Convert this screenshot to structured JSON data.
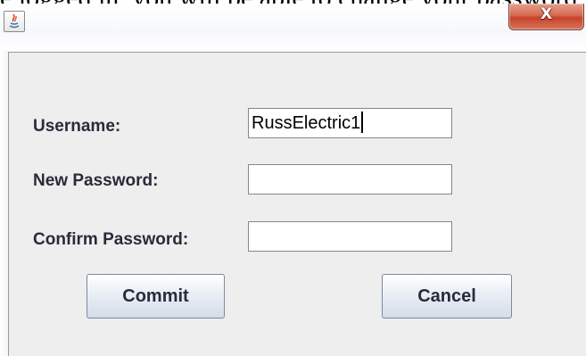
{
  "background_text": "e logged in, you will be able to change your password",
  "window": {
    "close_glyph": "X"
  },
  "form": {
    "username_label": "Username:",
    "username_value": "RussElectric1",
    "new_password_label": "New Password:",
    "new_password_value": "",
    "confirm_password_label": "Confirm Password:",
    "confirm_password_value": ""
  },
  "buttons": {
    "commit_label": "Commit",
    "cancel_label": "Cancel"
  },
  "icons": {
    "app_icon": "java-icon",
    "close_icon": "close-icon",
    "caret": "text-caret"
  },
  "colors": {
    "close_button": "#d76a50",
    "content_background": "#eeeeee",
    "label_text": "#2a2a3a"
  }
}
